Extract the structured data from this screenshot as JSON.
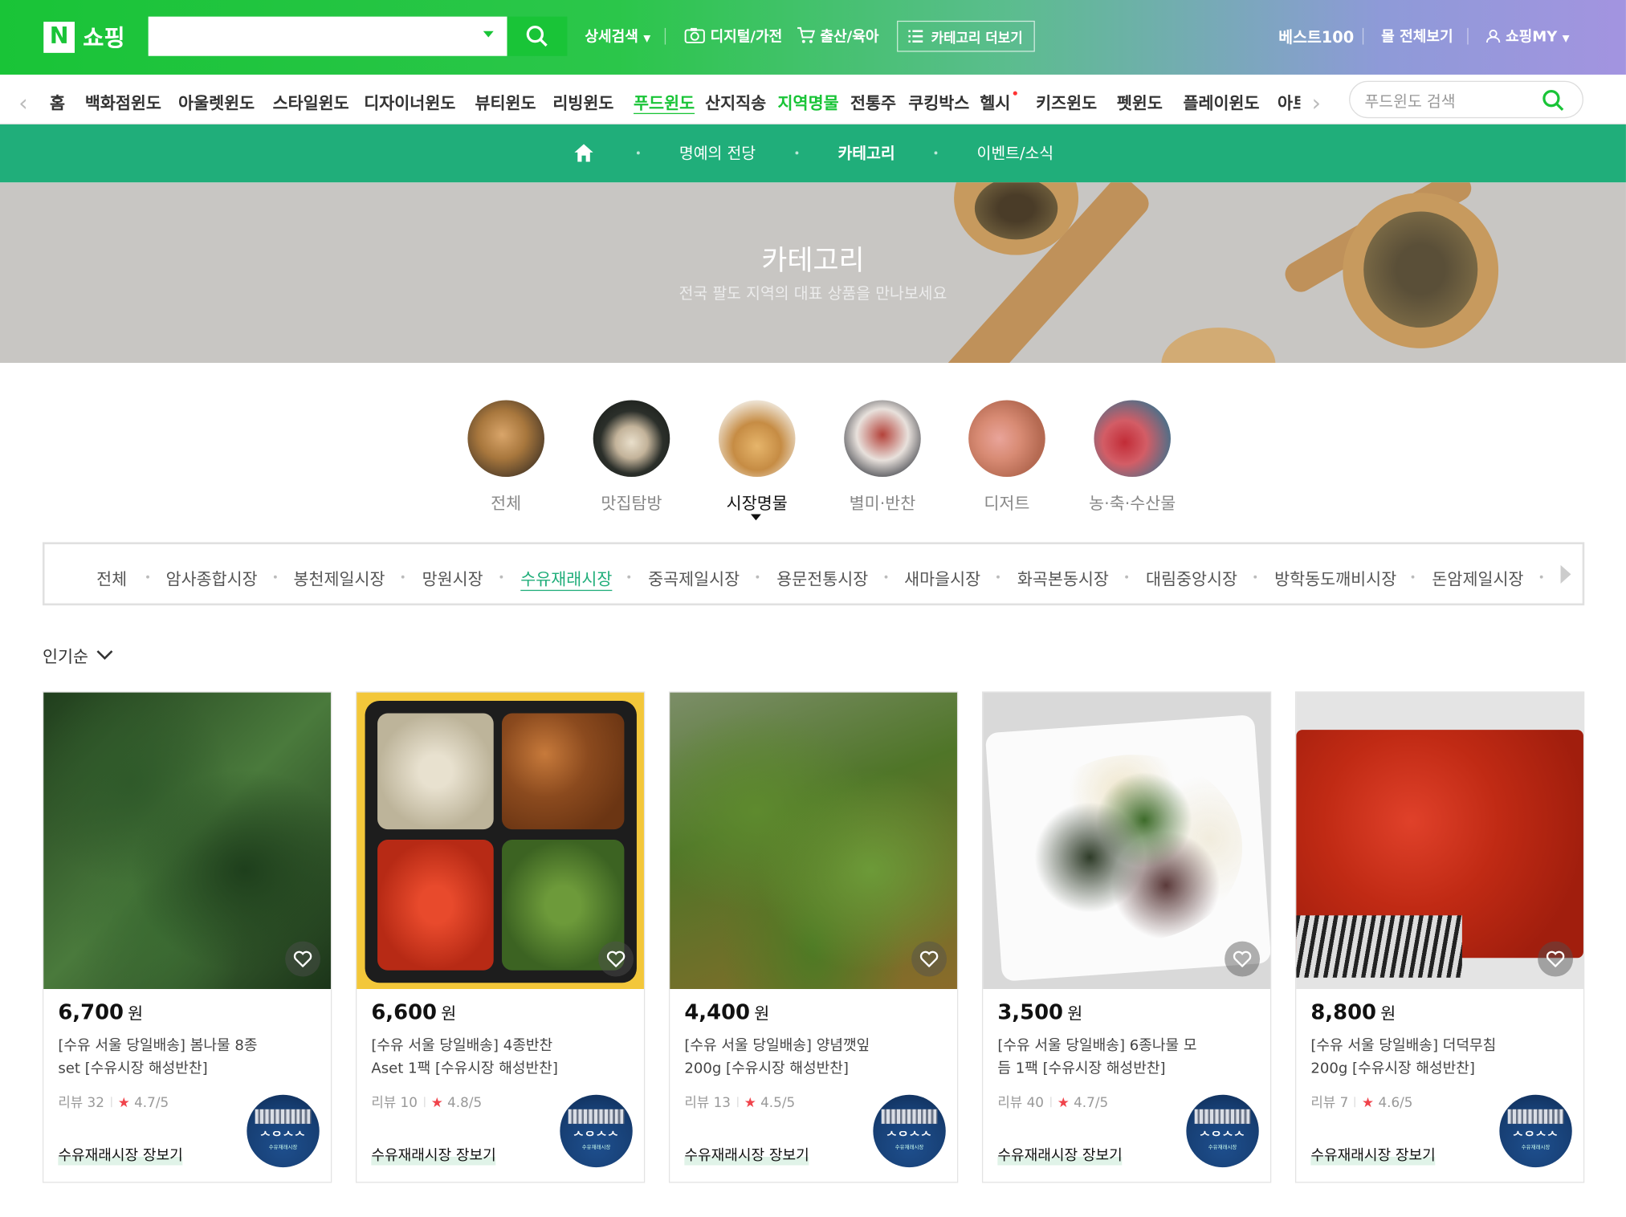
{
  "header": {
    "logo_letter": "N",
    "logo_text": "쇼핑",
    "search_placeholder": "",
    "links": [
      "상세검색",
      "디지털/가전",
      "출산/육아"
    ],
    "category_more": "카테고리 더보기",
    "right_links": [
      "베스트100",
      "몰 전체보기",
      "쇼핑MY"
    ]
  },
  "window_nav": {
    "items": [
      "홈",
      "백화점윈도",
      "아울렛윈도",
      "스타일윈도",
      "디자이너윈도",
      "뷰티윈도",
      "리빙윈도",
      "푸드윈도",
      "산지직송",
      "지역명물",
      "전통주",
      "쿠킹박스",
      "헬시",
      "키즈윈도",
      "펫윈도",
      "플레이윈도",
      "아트"
    ],
    "active": "푸드윈도",
    "search_placeholder": "푸드윈도 검색"
  },
  "food_nav": {
    "items": [
      "명예의 전당",
      "카테고리",
      "이벤트/소식"
    ],
    "active": "카테고리"
  },
  "banner": {
    "title": "카테고리",
    "subtitle": "전국 팔도 지역의 대표 상품을 만나보세요"
  },
  "circle_categories": {
    "items": [
      "전체",
      "맛집탐방",
      "시장명물",
      "별미·반찬",
      "디저트",
      "농·축·수산물"
    ],
    "active": "시장명물"
  },
  "market_tabs": {
    "items": [
      "전체",
      "암사종합시장",
      "봉천제일시장",
      "망원시장",
      "수유재래시장",
      "중곡제일시장",
      "용문전통시장",
      "새마을시장",
      "화곡본동시장",
      "대림중앙시장",
      "방학동도깨비시장",
      "돈암제일시장"
    ],
    "active": "수유재래시장"
  },
  "sort": {
    "label": "인기순"
  },
  "products": [
    {
      "price": "6,700",
      "won": "원",
      "title": "[수유 서울 당일배송] 봄나물 8종set [수유시장 해성반찬]",
      "review_label": "리뷰",
      "review_count": "32",
      "rating": "4.7/5",
      "store": "수유재래시장 장보기"
    },
    {
      "price": "6,600",
      "won": "원",
      "title": "[수유 서울 당일배송] 4종반찬 Aset 1팩 [수유시장 해성반찬]",
      "review_label": "리뷰",
      "review_count": "10",
      "rating": "4.8/5",
      "store": "수유재래시장 장보기"
    },
    {
      "price": "4,400",
      "won": "원",
      "title": "[수유 서울 당일배송] 양념깻잎 200g [수유시장 해성반찬]",
      "review_label": "리뷰",
      "review_count": "13",
      "rating": "4.5/5",
      "store": "수유재래시장 장보기"
    },
    {
      "price": "3,500",
      "won": "원",
      "title": "[수유 서울 당일배송] 6종나물 모듬 1팩 [수유시장 해성반찬]",
      "review_label": "리뷰",
      "review_count": "40",
      "rating": "4.7/5",
      "store": "수유재래시장 장보기"
    },
    {
      "price": "8,800",
      "won": "원",
      "title": "[수유 서울 당일배송] 더덕무침 200g [수유시장 해성반찬]",
      "review_label": "리뷰",
      "review_count": "7",
      "rating": "4.6/5",
      "store": "수유재래시장 장보기"
    }
  ],
  "store_logo_text": "ᄉᄋᄉᄉ",
  "store_logo_sub": "수유재래시장",
  "colors": {
    "naver_green": "#19c437",
    "food_green": "#20ae7a",
    "star_red": "#f0434b"
  },
  "icons": [
    "search-icon",
    "camera-icon",
    "cart-icon",
    "list-icon",
    "user-icon",
    "home-icon",
    "heart-icon",
    "chevron-left-icon",
    "chevron-right-icon",
    "chevron-down-icon"
  ]
}
